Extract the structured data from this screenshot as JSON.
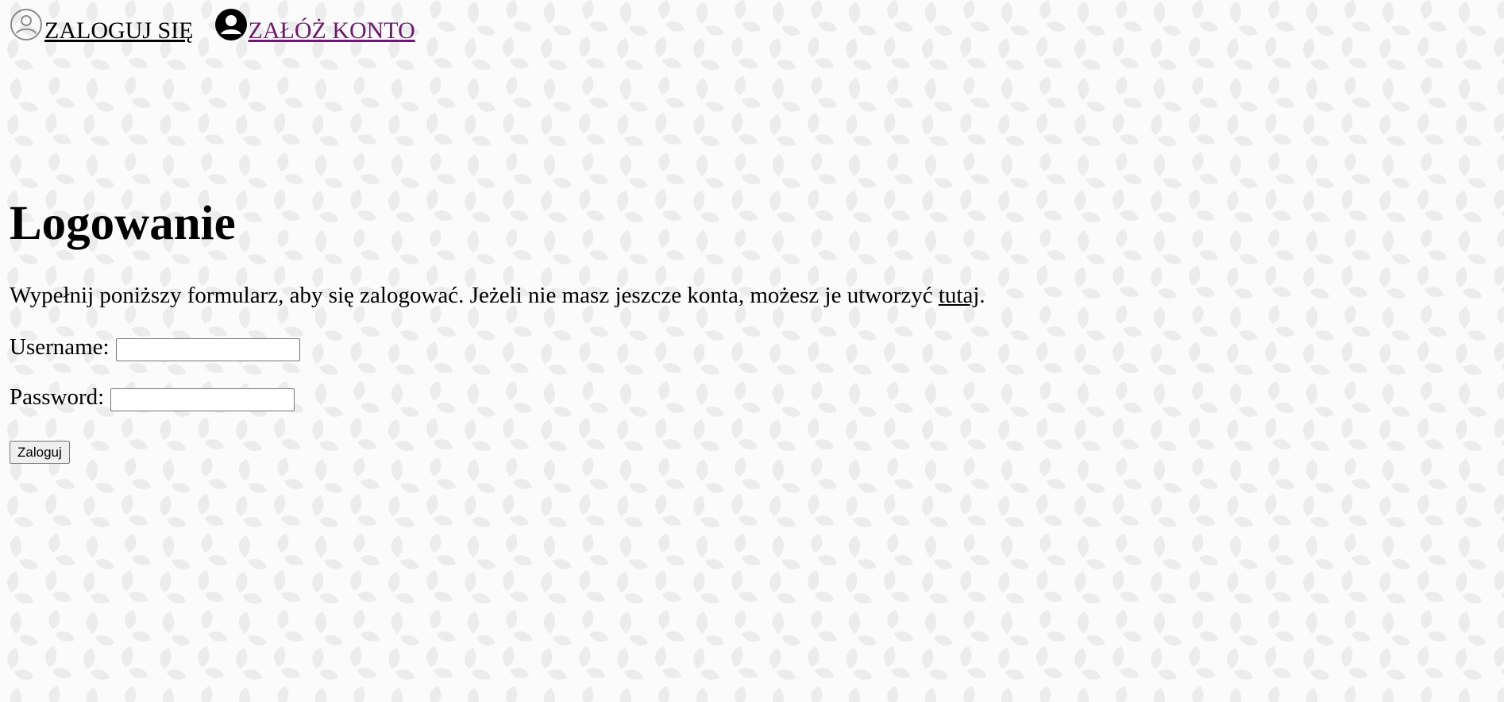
{
  "nav": {
    "login_label": "ZALOGUJ SIĘ",
    "register_label": "ZAŁÓŻ KONTO"
  },
  "page": {
    "title": "Logowanie",
    "intro_text": "Wypełnij poniższy formularz, aby się zalogować. Jeżeli nie masz jeszcze konta, możesz je utworzyć ",
    "intro_link": "tutaj",
    "intro_end": "."
  },
  "form": {
    "username_label": "Username:",
    "username_value": "",
    "password_label": "Password:",
    "password_value": "",
    "submit_label": "Zaloguj"
  },
  "colors": {
    "register_link": "#6a1b6b",
    "background": "#fbfbfb",
    "leaf_pattern": "#ececec"
  },
  "icons": {
    "login": "user-outline-icon",
    "register": "user-filled-icon"
  }
}
